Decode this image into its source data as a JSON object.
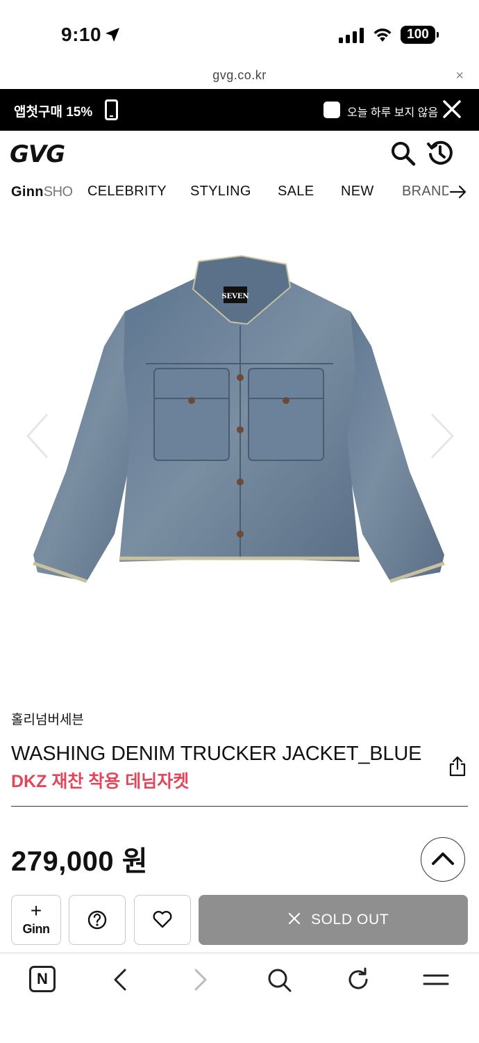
{
  "status_bar": {
    "time": "9:10",
    "battery": "100"
  },
  "url_bar": {
    "domain": "gvg.co.kr",
    "close": "×"
  },
  "promo_banner": {
    "text": "앱첫구매 15%",
    "hide_today_label": "오늘 하루 보지 않음"
  },
  "header": {
    "logo": "GVG"
  },
  "nav": {
    "ginn_bold": "Ginn",
    "ginn_light": "SHO",
    "items": [
      "CELEBRITY",
      "STYLING",
      "SALE",
      "NEW",
      "BRANDS"
    ]
  },
  "product": {
    "brand": "홀리넘버세븐",
    "title": "WASHING DENIM TRUCKER JACKET_BLUE",
    "subtitle": "DKZ 재찬 착용 데님자켓",
    "price": "279,000 원",
    "jacket_label": "SEVEN"
  },
  "actions": {
    "ginn_plus": "+",
    "ginn_label": "Ginn",
    "sold_out": "SOLD OUT"
  },
  "browser_bar": {
    "home_label": "N"
  },
  "colors": {
    "promo_bg": "#000000",
    "subtitle": "#e0475b",
    "sold_out_bg": "#8f8f8f",
    "denim": "#6f86a0"
  }
}
